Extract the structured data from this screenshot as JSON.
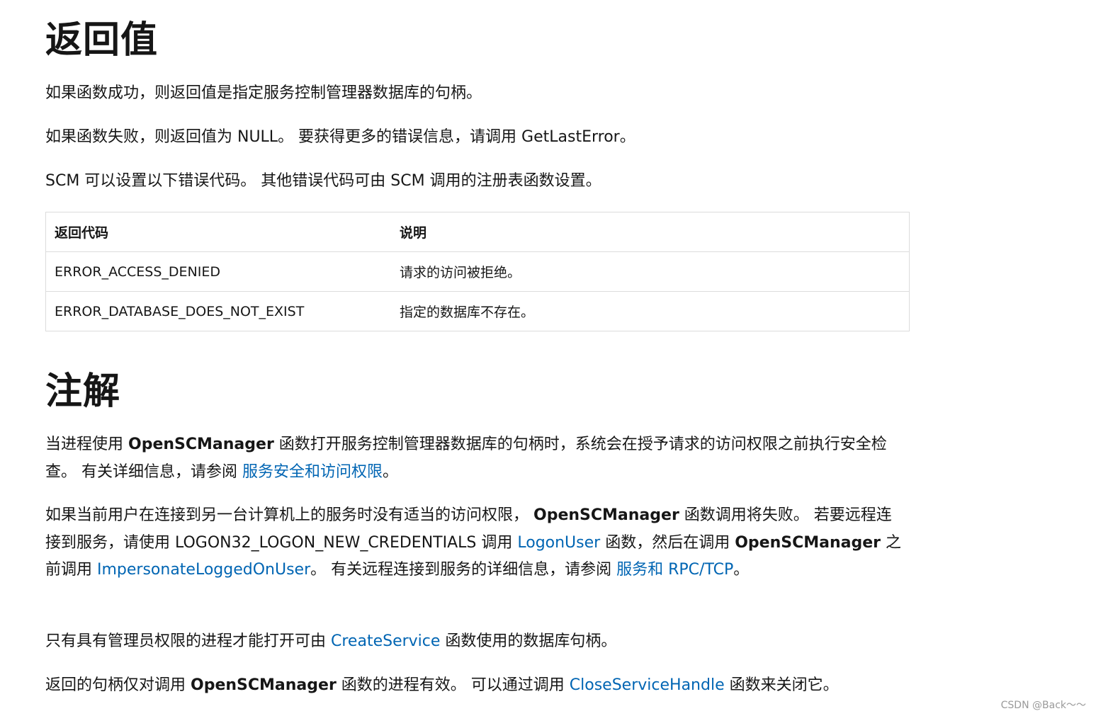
{
  "return_section": {
    "heading": "返回值",
    "p1": "如果函数成功，则返回值是指定服务控制管理器数据库的句柄。",
    "p2": "如果函数失败，则返回值为 NULL。 要获得更多的错误信息，请调用 GetLastError。",
    "p3": "SCM 可以设置以下错误代码。 其他错误代码可由 SCM 调用的注册表函数设置。",
    "table": {
      "headers": [
        "返回代码",
        "说明"
      ],
      "rows": [
        [
          "ERROR_ACCESS_DENIED",
          "请求的访问被拒绝。"
        ],
        [
          "ERROR_DATABASE_DOES_NOT_EXIST",
          "指定的数据库不存在。"
        ]
      ]
    }
  },
  "remarks_section": {
    "heading": "注解",
    "para1": {
      "t1": "当进程使用 ",
      "b1": "OpenSCManager",
      "t2": " 函数打开服务控制管理器数据库的句柄时，系统会在授予请求的访问权限之前执行安全检查。 有关详细信息，请参阅 ",
      "link1": "服务安全和访问权限",
      "t3": "。"
    },
    "para2": {
      "t1": "如果当前用户在连接到另一台计算机上的服务时没有适当的访问权限， ",
      "b1": "OpenSCManager",
      "t2": " 函数调用将失败。 若要远程连接到服务，请使用 LOGON32_LOGON_NEW_CREDENTIALS 调用 ",
      "link1": "LogonUser",
      "t3": " 函数，然后在调用 ",
      "b2": "OpenSCManager",
      "t4": " 之前调用 ",
      "link2": "ImpersonateLoggedOnUser",
      "t5": "。 有关远程连接到服务的详细信息，请参阅 ",
      "link3": "服务和 RPC/TCP",
      "t6": "。"
    },
    "para3": {
      "t1": "只有具有管理员权限的进程才能打开可由 ",
      "link1": "CreateService",
      "t2": " 函数使用的数据库句柄。"
    },
    "para4": {
      "t1": "返回的句柄仅对调用 ",
      "b1": "OpenSCManager",
      "t2": " 函数的进程有效。 可以通过调用 ",
      "link1": "CloseServiceHandle",
      "t3": " 函数来关闭它。"
    }
  },
  "watermark": "CSDN @Back～～",
  "colors": {
    "link": "#0065b3",
    "text": "#161616",
    "border": "#dcdcdc"
  }
}
